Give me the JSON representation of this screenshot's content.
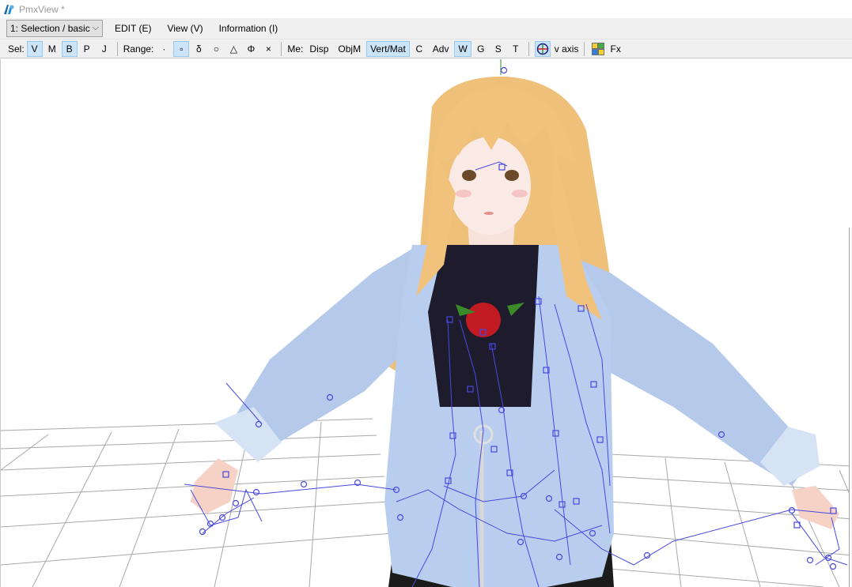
{
  "window": {
    "title": "PmxView *"
  },
  "menubar": {
    "mode_select": "1: Selection / basic",
    "items": [
      "EDIT (E)",
      "View (V)",
      "Information (I)"
    ]
  },
  "toolbar": {
    "sel_label": "Sel:",
    "sel_buttons": [
      {
        "label": "V",
        "active": true
      },
      {
        "label": "M",
        "active": false
      },
      {
        "label": "B",
        "active": true
      },
      {
        "label": "P",
        "active": false
      },
      {
        "label": "J",
        "active": false
      }
    ],
    "range_label": "Range:",
    "range_buttons": [
      {
        "label": "·",
        "active": false
      },
      {
        "label": "▫",
        "active": true
      },
      {
        "label": "δ",
        "active": false
      },
      {
        "label": "○",
        "active": false
      },
      {
        "label": "△",
        "active": false
      },
      {
        "label": "Φ",
        "active": false
      },
      {
        "label": "×",
        "active": false
      }
    ],
    "me_label": "Me:",
    "me_buttons": [
      {
        "label": "Disp",
        "active": false
      },
      {
        "label": "ObjM",
        "active": false
      },
      {
        "label": "Vert/Mat",
        "active": true
      },
      {
        "label": "C",
        "active": false
      },
      {
        "label": "Adv",
        "active": false
      },
      {
        "label": "W",
        "active": true
      },
      {
        "label": "G",
        "active": false
      },
      {
        "label": "S",
        "active": false
      },
      {
        "label": "T",
        "active": false
      }
    ],
    "axis_label": "v axis",
    "fx_label": "Fx",
    "axis_icon": "axis-gizmo-icon",
    "fx_icon": "color-grid-icon"
  },
  "colors": {
    "bone": "#4848e0",
    "hair": "#f3c47e",
    "jacket": "#b8cdee",
    "shirt": "#1d1b2b",
    "grid": "#a0a0a0"
  }
}
